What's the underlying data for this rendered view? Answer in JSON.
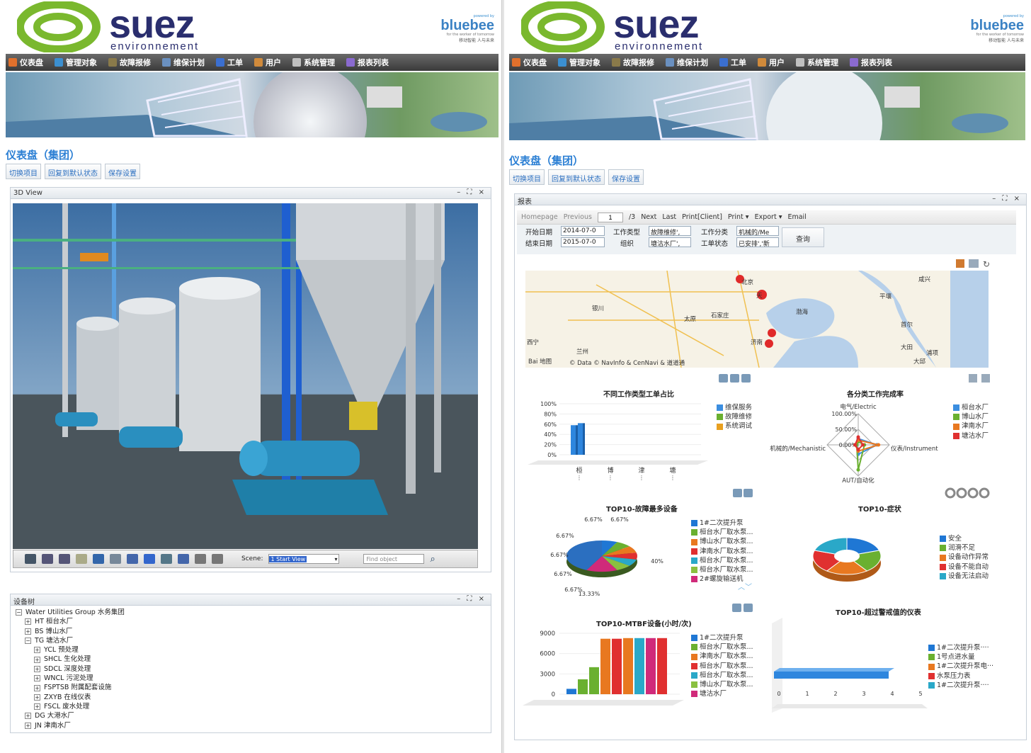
{
  "brand": {
    "name": "suez",
    "sub": "environnement",
    "bluebee_top": "powered by",
    "bluebee_name": "bluebee",
    "bluebee_tag": "for the worker of tomorrow",
    "bluebee_cn": "移动智能  人与未来"
  },
  "menu": [
    "仪表盘",
    "管理对象",
    "故障报修",
    "维保计划",
    "工单",
    "用户",
    "系统管理",
    "报表列表"
  ],
  "menu_colors": [
    "#e0702c",
    "#3b8fd0",
    "#8a7a4a",
    "#6a90c0",
    "#3b6fd0",
    "#d08a3b",
    "#c0c0c0",
    "#8a6ad0"
  ],
  "left": {
    "page_title": "仪表盘（集团）",
    "buttons": [
      "切换项目",
      "回复到默认状态",
      "保存设置"
    ],
    "view_panel_title": "3D View",
    "panel_tools": "– ⛶ ×",
    "scene_label": "Scene:",
    "scene_value": "1 Start View",
    "find_placeholder": "Find object",
    "tree_panel_title": "设备树",
    "tree": [
      {
        "level": 0,
        "toggle": "⊟",
        "text": "Water Utilities Group 水务集团"
      },
      {
        "level": 1,
        "toggle": "⊞",
        "text": "HT 桓台水厂"
      },
      {
        "level": 1,
        "toggle": "⊞",
        "text": "BS 博山水厂"
      },
      {
        "level": 1,
        "toggle": "⊟",
        "text": "TG 塘沽水厂"
      },
      {
        "level": 2,
        "toggle": "⊞",
        "text": "YCL 预处理"
      },
      {
        "level": 2,
        "toggle": "⊞",
        "text": "SHCL 生化处理"
      },
      {
        "level": 2,
        "toggle": "⊞",
        "text": "SDCL 深度处理"
      },
      {
        "level": 2,
        "toggle": "⊞",
        "text": "WNCL 污泥处理"
      },
      {
        "level": 2,
        "toggle": "⊞",
        "text": "FSPTSB 附属配套设施"
      },
      {
        "level": 2,
        "toggle": "⊞",
        "text": "ZXYB 在线仪表"
      },
      {
        "level": 2,
        "toggle": "⊞",
        "text": "FSCL 废水处理"
      },
      {
        "level": 1,
        "toggle": "⊞",
        "text": "DG 大港水厂"
      },
      {
        "level": 1,
        "toggle": "⊞",
        "text": "JN 津南水厂"
      }
    ]
  },
  "right": {
    "page_title": "仪表盘（集团）",
    "buttons": [
      "切换项目",
      "回复到默认状态",
      "保存设置"
    ],
    "report_panel_title": "报表",
    "toolbar": {
      "homepage": "Homepage",
      "previous": "Previous",
      "page": "1",
      "total": "/3",
      "next": "Next",
      "last": "Last",
      "print_client": "Print[Client]",
      "print": "Print ▾",
      "export": "Export ▾",
      "email": "Email"
    },
    "filters": {
      "start_label": "开始日期",
      "start_value": "2014-07-0",
      "end_label": "结束日期",
      "end_value": "2015-07-0",
      "type_label": "工作类型",
      "type_value": "故障维修',",
      "org_label": "组织",
      "org_value": "塘沽水厂',",
      "class_label": "工作分类",
      "class_value": "机械的/Me",
      "status_label": "工单状态",
      "status_value": "已安排','新",
      "query": "查询"
    },
    "map_labels": [
      {
        "t": "北京",
        "x": 305,
        "y": 10
      },
      {
        "t": "天",
        "x": 326,
        "y": 29
      },
      {
        "t": "银川",
        "x": 94,
        "y": 47
      },
      {
        "t": "太原",
        "x": 224,
        "y": 62
      },
      {
        "t": "石家庄",
        "x": 262,
        "y": 57
      },
      {
        "t": "渤海",
        "x": 382,
        "y": 52
      },
      {
        "t": "济南",
        "x": 318,
        "y": 95
      },
      {
        "t": "西宁",
        "x": 2,
        "y": 95
      },
      {
        "t": "兰州",
        "x": 72,
        "y": 108
      },
      {
        "t": "平壤",
        "x": 500,
        "y": 30
      },
      {
        "t": "首尔",
        "x": 530,
        "y": 70
      },
      {
        "t": "大田",
        "x": 530,
        "y": 102
      },
      {
        "t": "浦项",
        "x": 566,
        "y": 110
      },
      {
        "t": "大邱",
        "x": 548,
        "y": 122
      },
      {
        "t": "咸兴",
        "x": 555,
        "y": 6
      },
      {
        "t": "Bai 地图",
        "x": 4,
        "y": 122
      },
      {
        "t": "© Data © NavInfo & CenNavi & 道道通",
        "x": 62,
        "y": 124
      }
    ],
    "chart1": {
      "title": "不同工作类型工单占比",
      "legend": [
        "维保服务",
        "故障维修",
        "系统调试"
      ],
      "colors": [
        "#3b8ee0",
        "#6ab030",
        "#e8a020"
      ]
    },
    "chart2": {
      "title": "各分类工作完成率",
      "legend": [
        "桓台水厂",
        "博山水厂",
        "津南水厂",
        "塘沽水厂"
      ],
      "colors": [
        "#3b8ee0",
        "#6ab030",
        "#e87820",
        "#e03030"
      ]
    },
    "chart3": {
      "title": "TOP10-故障最多设备",
      "legend": [
        "1#二次提升泵",
        "桓台水厂取水泵...",
        "博山水厂取水泵...",
        "津南水厂取水泵...",
        "桓台水厂取水泵...",
        "桓台水厂取水泵...",
        "2#螺旋输送机"
      ],
      "colors": [
        "#1f77d4",
        "#6ab030",
        "#e87820",
        "#e03030",
        "#2aa8c8",
        "#8ac040",
        "#d02a7a"
      ]
    },
    "chart4": {
      "title": "TOP10-症状",
      "legend": [
        "安全",
        "润滑不足",
        "设备动作异常",
        "设备不能自动",
        "设备无法启动"
      ],
      "colors": [
        "#1f77d4",
        "#6ab030",
        "#e87820",
        "#e03030",
        "#2aa8c8"
      ]
    },
    "chart5": {
      "title": "TOP10-MTBF设备(小时/次)",
      "legend": [
        "1#二次提升泵",
        "桓台水厂取水泵...",
        "津南水厂取水泵...",
        "桓台水厂取水泵...",
        "桓台水厂取水泵...",
        "博山水厂取水泵...",
        "塘沽水厂"
      ],
      "colors": [
        "#1f77d4",
        "#6ab030",
        "#e87820",
        "#e03030",
        "#2aa8c8",
        "#8ac040",
        "#d02a7a"
      ]
    },
    "chart6": {
      "title": "TOP10-超过警戒值的仪表",
      "legend": [
        "1#二次提升泵····",
        "1号点进水量",
        "1#二次提升泵电···",
        "水泵压力表",
        "1#二次提升泵····"
      ],
      "colors": [
        "#1f77d4",
        "#6ab030",
        "#e87820",
        "#e03030",
        "#2aa8c8"
      ]
    }
  },
  "chart_data": [
    {
      "type": "bar",
      "title": "不同工作类型工单占比",
      "categories": [
        "桓",
        "博",
        "津",
        "塘"
      ],
      "ylim": [
        0,
        100
      ],
      "yticks": [
        "100%",
        "80%",
        "60%",
        "40%",
        "20%",
        "0%"
      ],
      "series": [
        {
          "name": "维保服务",
          "values": [
            58,
            62,
            0,
            0
          ]
        }
      ]
    },
    {
      "type": "radar",
      "title": "各分类工作完成率",
      "axes": [
        "电气/Electric",
        "仪表/Instrument",
        "AUT/自动化",
        "机械的/Mechanistic"
      ],
      "ticks": [
        "100.00%",
        "50.00%",
        "0.00%"
      ],
      "series": [
        {
          "name": "桓台水厂",
          "values": [
            20,
            60,
            30,
            5
          ]
        },
        {
          "name": "博山水厂",
          "values": [
            10,
            20,
            80,
            5
          ]
        },
        {
          "name": "津南水厂",
          "values": [
            15,
            65,
            20,
            10
          ]
        },
        {
          "name": "塘沽水厂",
          "values": [
            25,
            15,
            15,
            10
          ]
        }
      ]
    },
    {
      "type": "pie",
      "title": "TOP10-故障最多设备",
      "labels": [
        "6.67%",
        "6.67%",
        "6.67%",
        "6.67%",
        "6.67%",
        "6.67%",
        "13.33%",
        "40%"
      ],
      "values": [
        6.67,
        6.67,
        6.67,
        6.67,
        6.67,
        6.67,
        13.33,
        40
      ]
    },
    {
      "type": "pie",
      "title": "TOP10-症状",
      "values": [
        20,
        20,
        20,
        20,
        20
      ]
    },
    {
      "type": "bar",
      "title": "TOP10-MTBF设备(小时/次)",
      "ylim": [
        0,
        9000
      ],
      "yticks": [
        "9000",
        "6000",
        "3000",
        "0"
      ],
      "values": [
        800,
        2200,
        4000,
        8200,
        8200,
        8300,
        8300,
        8300,
        8300
      ]
    },
    {
      "type": "bar",
      "title": "TOP10-超过警戒值的仪表",
      "orientation": "horizontal",
      "xticks": [
        "0",
        "1",
        "2",
        "3",
        "4",
        "5"
      ],
      "xlim": [
        0,
        5
      ],
      "values": [
        4.0
      ]
    }
  ]
}
